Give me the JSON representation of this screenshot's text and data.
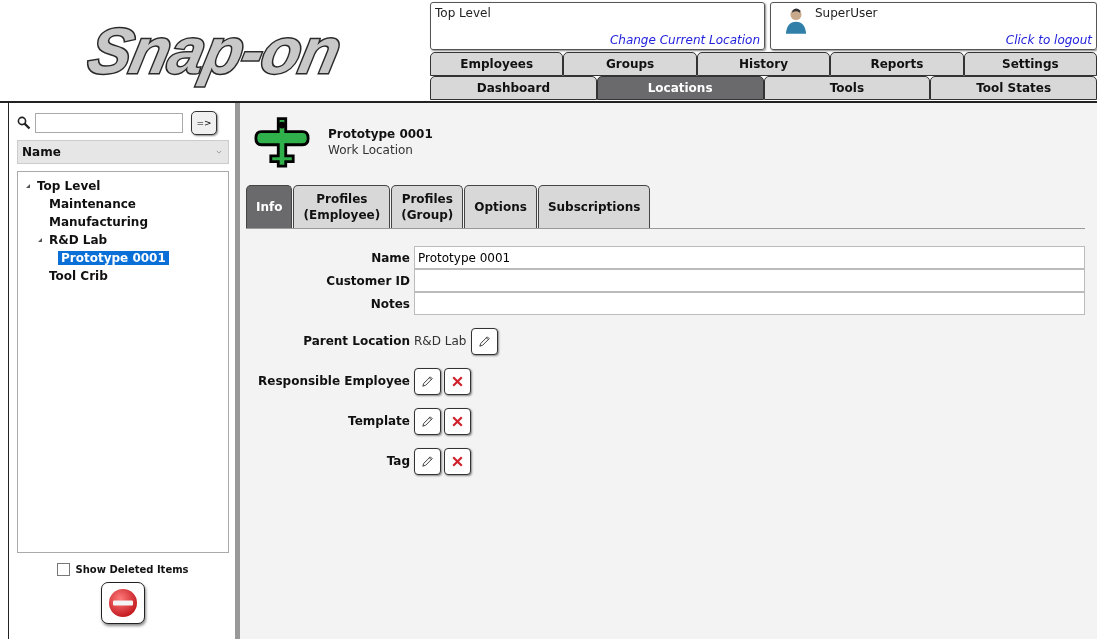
{
  "logo": {
    "text": "Snap-on"
  },
  "location_box": {
    "current": "Top Level",
    "link": "Change Current Location"
  },
  "user_box": {
    "user": "SuperUser",
    "link": "Click to logout"
  },
  "nav_rows": [
    {
      "tabs": [
        {
          "label": "Employees",
          "selected": false
        },
        {
          "label": "Groups",
          "selected": false
        },
        {
          "label": "History",
          "selected": false
        },
        {
          "label": "Reports",
          "selected": false
        },
        {
          "label": "Settings",
          "selected": false
        }
      ]
    },
    {
      "tabs": [
        {
          "label": "Dashboard",
          "selected": false
        },
        {
          "label": "Locations",
          "selected": true
        },
        {
          "label": "Tools",
          "selected": false
        },
        {
          "label": "Tool States",
          "selected": false
        }
      ]
    }
  ],
  "sidebar": {
    "search_button": "=>",
    "sort": {
      "value": "Name"
    },
    "tree": [
      {
        "label": "Top Level",
        "expanded": true,
        "selected": false,
        "children": [
          {
            "label": "Maintenance",
            "selected": false
          },
          {
            "label": "Manufacturing",
            "selected": false
          },
          {
            "label": "R&D Lab",
            "expanded": true,
            "selected": false,
            "children": [
              {
                "label": "Prototype 0001",
                "selected": true
              }
            ]
          },
          {
            "label": "Tool Crib",
            "selected": false
          }
        ]
      }
    ],
    "show_deleted": {
      "label": "Show Deleted Items",
      "checked": false
    }
  },
  "header": {
    "title": "Prototype 0001",
    "subtitle": "Work Location"
  },
  "tabs": [
    {
      "label": "Info",
      "selected": true
    },
    {
      "label": "Profiles\n(Employee)",
      "selected": false
    },
    {
      "label": "Profiles\n(Group)",
      "selected": false
    },
    {
      "label": "Options",
      "selected": false
    },
    {
      "label": "Subscriptions",
      "selected": false
    }
  ],
  "form": [
    {
      "kind": "text",
      "label": "Name",
      "value": "Prototype 0001"
    },
    {
      "kind": "text",
      "label": "Customer ID"
    },
    {
      "kind": "text",
      "label": "Notes"
    },
    {
      "kind": "pick",
      "label": "Parent Location",
      "value": "R&D Lab",
      "clearable": false
    },
    {
      "kind": "pick",
      "label": "Responsible Employee",
      "clearable": true
    },
    {
      "kind": "pick",
      "label": "Template",
      "clearable": true
    },
    {
      "kind": "pick",
      "label": "Tag",
      "clearable": true
    }
  ]
}
